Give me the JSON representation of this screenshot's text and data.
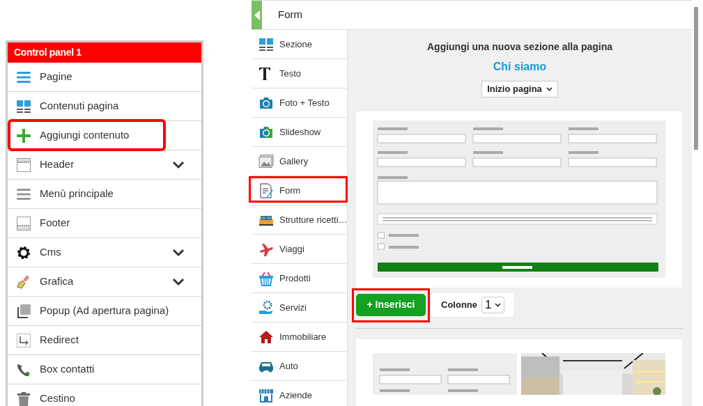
{
  "control_panel": {
    "title": "Control panel 1",
    "items": [
      {
        "label": "Pagine",
        "expandable": false,
        "highlighted": false
      },
      {
        "label": "Contenuti pagina",
        "expandable": false,
        "highlighted": false
      },
      {
        "label": "Aggiungi contenuto",
        "expandable": false,
        "highlighted": true
      },
      {
        "label": "Header",
        "expandable": true,
        "highlighted": false
      },
      {
        "label": "Menù principale",
        "expandable": false,
        "highlighted": false
      },
      {
        "label": "Footer",
        "expandable": false,
        "highlighted": false
      },
      {
        "label": "Cms",
        "expandable": true,
        "highlighted": false
      },
      {
        "label": "Grafica",
        "expandable": true,
        "highlighted": false
      },
      {
        "label": "Popup (Ad apertura pagina)",
        "expandable": false,
        "highlighted": false
      },
      {
        "label": "Redirect",
        "expandable": false,
        "highlighted": false
      },
      {
        "label": "Box contatti",
        "expandable": false,
        "highlighted": false
      },
      {
        "label": "Cestino",
        "expandable": false,
        "highlighted": false
      }
    ]
  },
  "editor": {
    "title": "Form",
    "menu": [
      {
        "label": "Sezione",
        "selected": false
      },
      {
        "label": "Testo",
        "selected": false
      },
      {
        "label": "Foto + Testo",
        "selected": false
      },
      {
        "label": "Slideshow",
        "selected": false
      },
      {
        "label": "Gallery",
        "selected": false
      },
      {
        "label": "Form",
        "selected": true
      },
      {
        "label": "Strutture ricetti…",
        "selected": false
      },
      {
        "label": "Viaggi",
        "selected": false
      },
      {
        "label": "Prodotti",
        "selected": false
      },
      {
        "label": "Servizi",
        "selected": false
      },
      {
        "label": "Immobiliare",
        "selected": false
      },
      {
        "label": "Auto",
        "selected": false
      },
      {
        "label": "Aziende",
        "selected": false
      }
    ],
    "heading": "Aggiungi una nuova sezione alla pagina",
    "page_name": "Chi siamo",
    "position_select": "Inizio pagina",
    "insert_button": {
      "label": "+ Inserisci",
      "highlighted": true
    },
    "columns_label": "Colonne",
    "columns_value": "1"
  }
}
